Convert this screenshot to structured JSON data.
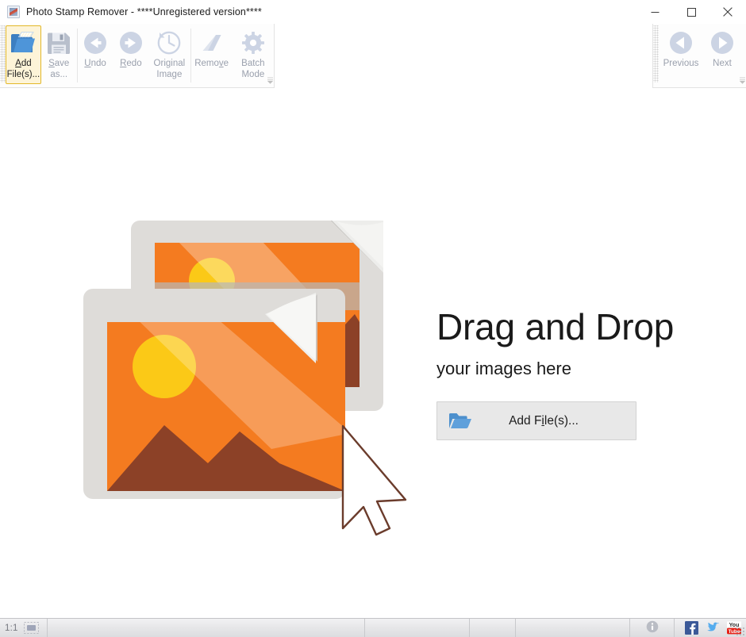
{
  "window": {
    "title": "Photo Stamp Remover - ****Unregistered version****",
    "icon": "app-photo-icon",
    "controls": {
      "minimize": "minimize-icon",
      "maximize": "maximize-icon",
      "close": "close-icon"
    }
  },
  "ribbon": {
    "left_group": {
      "buttons": [
        {
          "id": "add-files",
          "label": "Add\nFile(s)...",
          "accel": "A",
          "icon": "folder-add-icon",
          "state": "highlighted"
        },
        {
          "id": "save-as",
          "label": "Save\nas...",
          "accel": "S",
          "icon": "floppy-save-icon",
          "state": "disabled"
        },
        {
          "id": "undo",
          "label": "Undo",
          "accel": "U",
          "icon": "arrow-left-circle-icon",
          "state": "disabled"
        },
        {
          "id": "redo",
          "label": "Redo",
          "accel": "R",
          "icon": "arrow-right-circle-icon",
          "state": "disabled"
        },
        {
          "id": "original-image",
          "label": "Original\nImage",
          "accel": "",
          "icon": "clock-history-icon",
          "state": "disabled"
        },
        {
          "id": "remove",
          "label": "Remove",
          "accel": "v",
          "icon": "eraser-icon",
          "state": "disabled"
        },
        {
          "id": "batch-mode",
          "label": "Batch\nMode",
          "accel": "",
          "icon": "gear-icon",
          "state": "disabled"
        }
      ],
      "expander": "expand-toolbar-chevron"
    },
    "right_group": {
      "buttons": [
        {
          "id": "previous",
          "label": "Previous",
          "icon": "chevron-left-circle-icon",
          "state": "disabled"
        },
        {
          "id": "next",
          "label": "Next",
          "icon": "chevron-right-circle-icon",
          "state": "disabled"
        }
      ],
      "expander": "expand-toolbar-chevron"
    }
  },
  "dropzone": {
    "title": "Drag and Drop",
    "subtitle": "your images here",
    "button": {
      "label_before": "Add F",
      "label_accel": "i",
      "label_after": "le(s)...",
      "full_label": "Add File(s)...",
      "icon": "open-folder-icon"
    },
    "illustration": "two-photos-with-cursor-icon"
  },
  "statusbar": {
    "zoom_ratio": "1:1",
    "fit_icon": "fit-to-window-icon",
    "message": "",
    "panel_2": "",
    "panel_3": "",
    "panel_4": "",
    "info_icon": "info-icon",
    "social": [
      {
        "id": "facebook",
        "icon": "facebook-icon",
        "label": "f"
      },
      {
        "id": "twitter",
        "icon": "twitter-bird-icon",
        "label": ""
      },
      {
        "id": "youtube",
        "icon": "youtube-icon",
        "label_top": "You",
        "label_bottom": "Tube"
      }
    ],
    "resize_grip": "resize-grip-icon"
  },
  "colors": {
    "accent_orange": "#F47B20",
    "sun_yellow": "#FCD116",
    "mountain_brown": "#8C4127",
    "frame_grey": "#DEDDDB",
    "highlight_border": "#E3B829",
    "highlight_fill": "#FDF4D8",
    "icon_blue": "#4D90CD",
    "disabled_grey": "#9AA0AD",
    "facebook_blue": "#3B5998",
    "twitter_blue": "#55ACEE",
    "youtube_red": "#E62117"
  }
}
